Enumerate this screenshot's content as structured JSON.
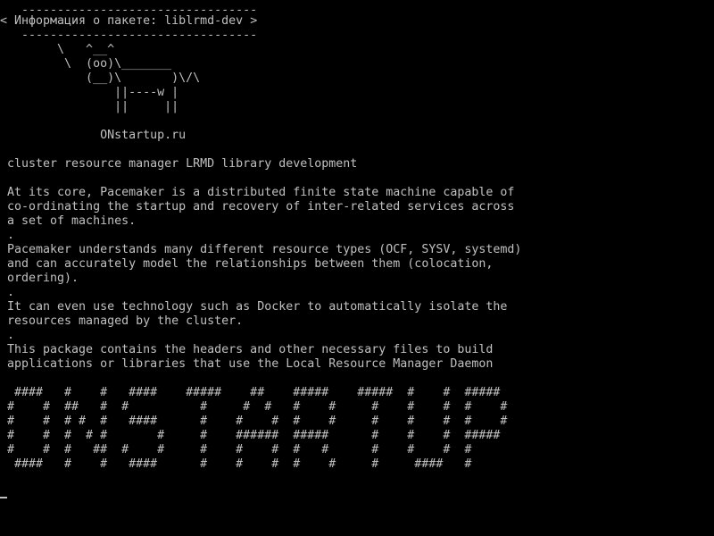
{
  "bubble": {
    "border_top": "  ---------------------------------",
    "text": "< Информация о пакете: liblrmd-dev >",
    "border_bottom": "  ---------------------------------"
  },
  "cow": [
    "       \\   ^__^",
    "        \\  (oo)\\_______",
    "           (__)\\       )\\/\\",
    "               ||----w |",
    "               ||     ||"
  ],
  "site": "             ONstartup.ru",
  "summary": "cluster resource manager LRMD library development",
  "description": [
    "At its core, Pacemaker is a distributed finite state machine capable of",
    "co-ordinating the startup and recovery of inter-related services across",
    "a set of machines.",
    ".",
    "Pacemaker understands many different resource types (OCF, SYSV, systemd)",
    "and can accurately model the relationships between them (colocation,",
    "ordering).",
    ".",
    "It can even use technology such as Docker to automatically isolate the",
    "resources managed by the cluster.",
    ".",
    "This package contains the headers and other necessary files to build",
    "applications or libraries that use the Local Resource Manager Daemon"
  ],
  "banner": [
    " ####   #    #   ####    #####    ##    #####    #####  #    #  #####",
    "#    #  ##   #  #          #     #  #   #    #     #    #    #  #    #",
    "#    #  # #  #   ####      #    #    #  #    #     #    #    #  #    #",
    "#    #  #  # #       #     #    ######  #####      #    #    #  #####",
    "#    #  #   ##  #    #     #    #    #  #   #      #    #    #  #",
    " ####   #    #   ####      #    #    #  #    #     #     ####   #"
  ]
}
